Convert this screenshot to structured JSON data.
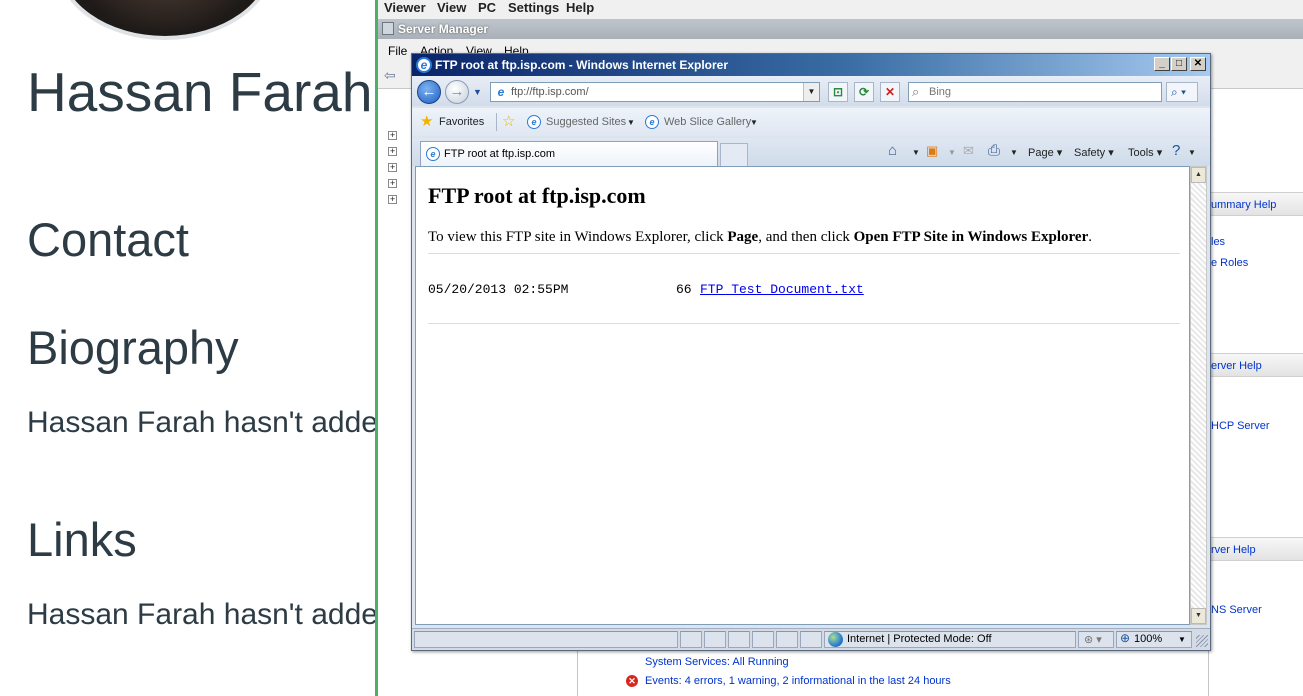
{
  "profile": {
    "name": "Hassan Farah",
    "contact_heading": "Contact",
    "biography_heading": "Biography",
    "biography_text": "Hassan Farah hasn't adde",
    "links_heading": "Links",
    "links_text": "Hassan Farah hasn't adde"
  },
  "viewer_menu": {
    "items": [
      "Viewer",
      "View",
      "PC",
      "Settings",
      "Help"
    ]
  },
  "server_manager": {
    "title": "Server Manager",
    "menu": [
      "File",
      "Action",
      "View",
      "Help"
    ],
    "right_pane": {
      "links": [
        "ummary Help",
        "les",
        "e Roles",
        "erver Help",
        "HCP Server",
        "rver Help",
        "NS Server"
      ]
    },
    "status": {
      "services": "System Services: All Running",
      "events": "Events: 4 errors, 1 warning, 2 informational in the last 24 hours"
    }
  },
  "ie": {
    "window_title": "FTP root at ftp.isp.com - Windows Internet Explorer",
    "address": "ftp://ftp.isp.com/",
    "search_placeholder": "Bing",
    "favorites_label": "Favorites",
    "suggested_sites": "Suggested Sites",
    "web_slice_gallery": "Web Slice Gallery",
    "tab_label": "FTP root at ftp.isp.com",
    "commands": {
      "page": "Page",
      "safety": "Safety",
      "tools": "Tools"
    },
    "status": {
      "zone": "Internet | Protected Mode: Off",
      "zoom": "100%"
    }
  },
  "ftp_page": {
    "title": "FTP root at ftp.isp.com",
    "instructions_pre": "To view this FTP site in Windows Explorer, click ",
    "instructions_page": "Page",
    "instructions_mid": ", and then click ",
    "instructions_action": "Open FTP Site in Windows Explorer",
    "instructions_post": ".",
    "files": [
      {
        "date": "05/20/2013 02:55PM",
        "size": "66",
        "name": "FTP Test Document.txt"
      }
    ]
  }
}
